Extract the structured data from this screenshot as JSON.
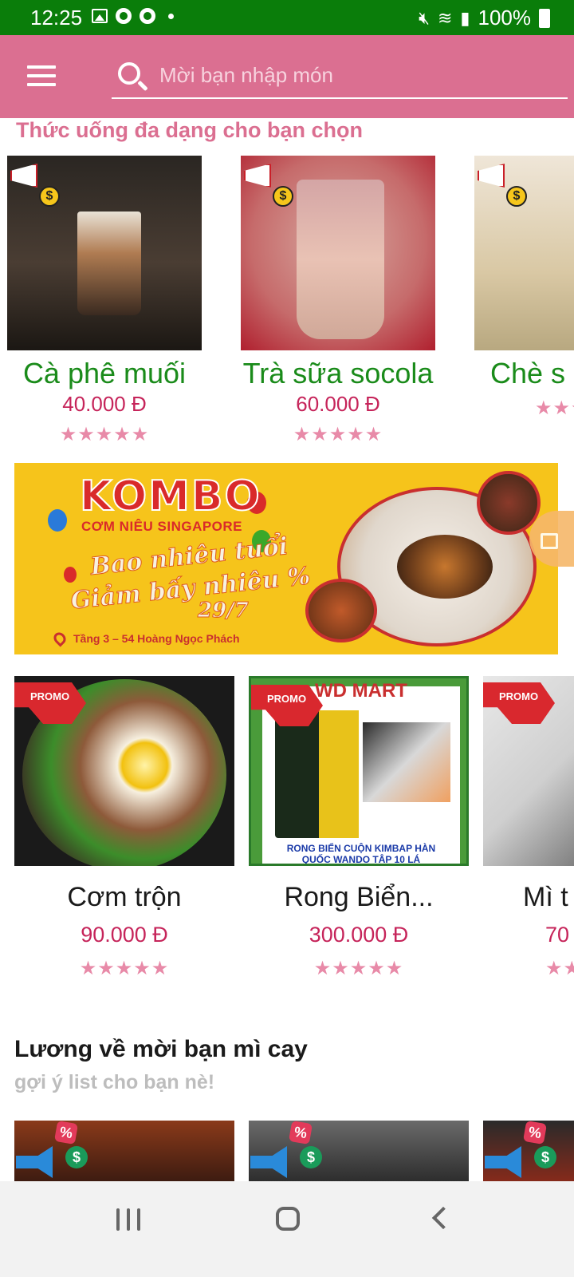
{
  "status_bar": {
    "time": "12:25",
    "battery": "100%",
    "icons": [
      "image-icon",
      "chrome-icon",
      "chrome-icon",
      "dot-icon",
      "mute-icon",
      "wifi-icon",
      "signal-icon",
      "battery-icon"
    ]
  },
  "header": {
    "search_placeholder": "Mời bạn nhập món",
    "accent_color": "#db6f91",
    "status_bar_color": "#0a7d0a"
  },
  "drinks_section": {
    "title": "Thức uống đa dạng cho bạn chọn",
    "items": [
      {
        "name": "Cà phê muối",
        "price": "40.000 Đ",
        "rating": 5
      },
      {
        "name": "Trà sữa socola",
        "price": "60.000 Đ",
        "rating": 5
      },
      {
        "name": "Chè s",
        "price": "",
        "rating": 5
      }
    ]
  },
  "banner": {
    "headline": "KOMBO",
    "subheadline": "CƠM NIÊU SINGAPORE",
    "slogan_line1": "Bao nhiêu tuổi",
    "slogan_line2": "Giảm bấy nhiêu %",
    "date": "29/7",
    "address": "Tầng 3 – 54 Hoàng Ngọc Phách"
  },
  "promo_section": {
    "tag_label": "PROMO",
    "items": [
      {
        "name": "Cơm trộn",
        "price": "90.000 Đ",
        "rating": 5
      },
      {
        "name": "Rong Biển...",
        "price": "300.000 Đ",
        "rating": 5,
        "image_brand": "WD MART",
        "image_caption_line1": "RONG BIỂN CUỘN KIMBAP HÀN",
        "image_caption_line2": "QUỐC WANDO TẬP 10 LÁ"
      },
      {
        "name": "Mì t",
        "price": "70",
        "rating": 5
      }
    ]
  },
  "list_section": {
    "title": "Lương về mời bạn mì cay",
    "subtitle": "gợi ý list cho bạn nè!",
    "badges": {
      "percent": "%",
      "coin": "$"
    }
  },
  "drink_badge_coin": "$",
  "stars_text": "★★★★★"
}
